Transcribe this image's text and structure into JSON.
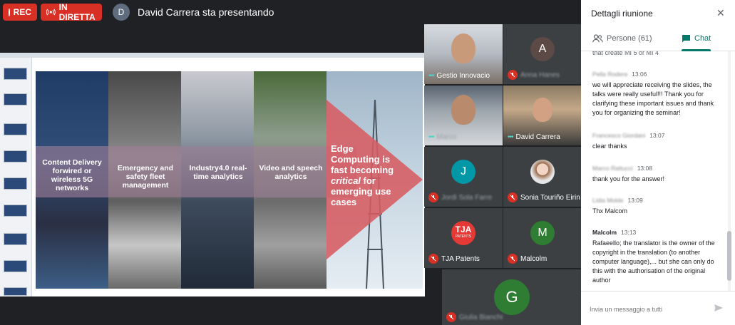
{
  "topbar": {
    "rec_label": "REC",
    "live_label": "IN DIRETTA",
    "presenter_initial": "D",
    "presenter_text": "David Carrera sta presentando"
  },
  "slide": {
    "labels": [
      "Content Delivery forwired or wireless 5G networks",
      "Emergency and safety fleet management",
      "Industry4.0 real-time analytics",
      "Video and speech analytics"
    ],
    "edge_lead": "Edge Computing is fast becoming ",
    "edge_emph": "critical",
    "edge_tail": " for emerging use cases"
  },
  "participants": [
    {
      "name": "Gestio Innovacio",
      "type": "video",
      "mic": "on"
    },
    {
      "initial": "A",
      "name": "Anna Hanes",
      "mic": "off",
      "color": "#5b4a45",
      "name_blurred": true
    },
    {
      "name": "Marco",
      "type": "video",
      "mic": "on",
      "name_blurred": true
    },
    {
      "name": "David Carrera",
      "type": "video",
      "mic": "on"
    },
    {
      "initial": "J",
      "name": "Jordi Sola Farre",
      "mic": "off",
      "color": "#0097a7",
      "name_blurred": true
    },
    {
      "name": "Sonia Touriño Eirin",
      "type": "photo",
      "mic": "off"
    },
    {
      "initial": "TJA",
      "sub": "PATENTS",
      "name": "TJA Patents",
      "mic": "off",
      "color": "#e53935"
    },
    {
      "initial": "M",
      "name": "Malcolm",
      "mic": "off",
      "color": "#2e7d32"
    },
    {
      "initial": "G",
      "name": "Giulia Bianchi",
      "mic": "off",
      "color": "#2e7d32",
      "name_blurred": true
    }
  ],
  "panel": {
    "title": "Dettagli riunione",
    "people_tab": "Persone (61)",
    "chat_tab": "Chat",
    "composer_placeholder": "Invia un messaggio a tutti"
  },
  "chat": [
    {
      "sender": "",
      "time": "",
      "text": "that create MI 5 or MI 4",
      "partial": true
    },
    {
      "sender": "Pella Rodera",
      "sender_blurred": true,
      "time": "13:06",
      "text": "we will appreciate receiving the slides, the talks were really useful!!! Thank you for clarifying these important issues and thank you for organizing the seminar!"
    },
    {
      "sender": "Francesco Giordani",
      "sender_blurred": true,
      "time": "13:07",
      "text": "clear thanks"
    },
    {
      "sender": "Marco Rattucci",
      "sender_blurred": true,
      "time": "13:08",
      "text": "thank you for the answer!"
    },
    {
      "sender": "Lidia Molde",
      "sender_blurred": true,
      "time": "13:09",
      "text": "Thx Malcom"
    },
    {
      "sender": "Malcolm",
      "time": "13:13",
      "text": "Rafaeello; the translator is the owner of the copyright in the translation (to another computer language),... but she can only do this with the authorisation of the original author"
    }
  ],
  "colors": {
    "rec_red": "#d93025",
    "accent_teal": "#00796b",
    "background": "#202124"
  }
}
